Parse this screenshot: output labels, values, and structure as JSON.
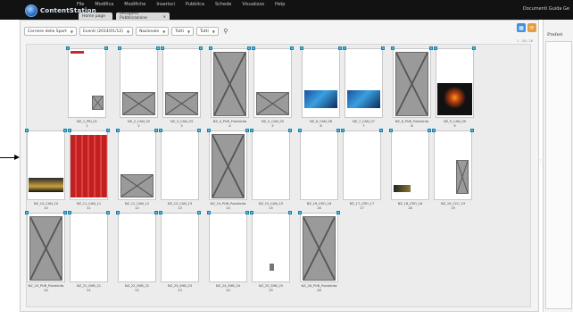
{
  "app": {
    "logo_text": "ContentStation",
    "menu": [
      "File",
      "Modifica",
      "Modifiche",
      "Inserisci",
      "Pubblica",
      "Schede",
      "Visualizza",
      "Help"
    ],
    "user_text": "Documenti Guida Ge"
  },
  "tabs": [
    {
      "label": "Home page"
    },
    {
      "label": "Recupero Pubblicazione"
    }
  ],
  "toolbar": {
    "filters": [
      "Corriere dello Sport",
      "Eventi (2014/01/12)",
      "Nazionale",
      "Tutti",
      "Tutti"
    ]
  },
  "count_label": "1 - 28 / 28",
  "right_panel": {
    "title": "Preferi"
  },
  "pages": [
    {
      "label": "NZ_1_PRI_01",
      "num": "1",
      "type": "cover"
    },
    {
      "label": "NZ_2_CAN_02",
      "num": "2",
      "type": "bottom-ph"
    },
    {
      "label": "NZ_3_CAN_03",
      "num": "3",
      "type": "bottom-ph"
    },
    {
      "label": "NZ_4_PUB_Pubblicita",
      "num": "4",
      "type": "full-ph"
    },
    {
      "label": "NZ_5_CAN_05",
      "num": "5",
      "type": "bottom-ph"
    },
    {
      "label": "NZ_6_CAN_06",
      "num": "6",
      "type": "ad-blue"
    },
    {
      "label": "NZ_7_CAN_07",
      "num": "7",
      "type": "ad-blue"
    },
    {
      "label": "NZ_8_PUB_Pubblicita",
      "num": "8",
      "type": "full-ph"
    },
    {
      "label": "NZ_9_CAN_09",
      "num": "9",
      "type": "ad-dark"
    },
    {
      "label": "NZ_10_CAN_10",
      "num": "10",
      "type": "bottom-dark"
    },
    {
      "label": "NZ_11_CAN_11",
      "num": "11",
      "type": "red"
    },
    {
      "label": "NZ_12_CAN_12",
      "num": "12",
      "type": "bottom-ph"
    },
    {
      "label": "NZ_13_CAN_13",
      "num": "13",
      "type": "blank"
    },
    {
      "label": "NZ_14_PUB_Pubblicita",
      "num": "14",
      "type": "full-ph"
    },
    {
      "label": "NZ_15_CAN_15",
      "num": "15",
      "type": "blank"
    },
    {
      "label": "NZ_16_CRO_16",
      "num": "16",
      "type": "blank"
    },
    {
      "label": "NZ_17_CRO_17",
      "num": "17",
      "type": "blank"
    },
    {
      "label": "NZ_18_CRO_18",
      "num": "18",
      "type": "small-img"
    },
    {
      "label": "NZ_19_CCC_19",
      "num": "19",
      "type": "right-ph"
    },
    {
      "label": "NZ_20_PUB_Pubblicita",
      "num": "20",
      "type": "full-ph"
    },
    {
      "label": "NZ_21_SHB_21",
      "num": "21",
      "type": "blank"
    },
    {
      "label": "NZ_22_SHB_22",
      "num": "22",
      "type": "blank"
    },
    {
      "label": "NZ_23_SHB_23",
      "num": "23",
      "type": "blank"
    },
    {
      "label": "NZ_24_SHB_24",
      "num": "24",
      "type": "blank"
    },
    {
      "label": "NZ_25_SHB_25",
      "num": "25",
      "type": "tiny"
    },
    {
      "label": "NZ_26_PUB_Pubblicita",
      "num": "26",
      "type": "full-ph"
    }
  ]
}
